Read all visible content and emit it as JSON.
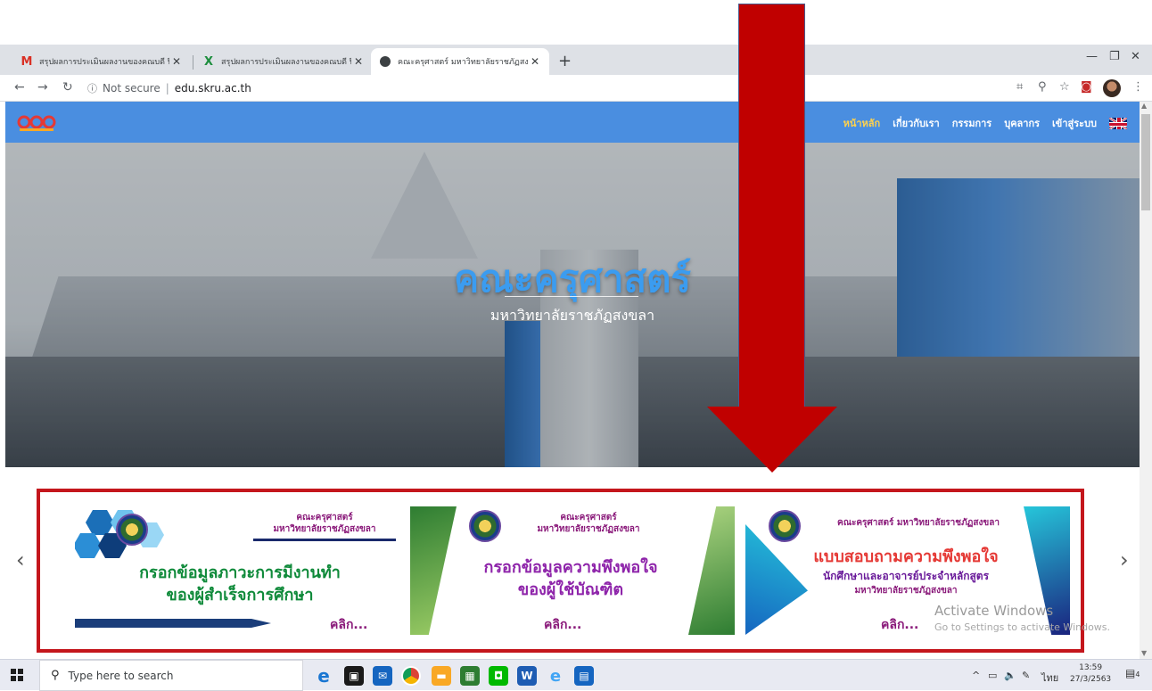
{
  "browser": {
    "tabs": [
      {
        "label": "สรุปผลการประเมินผลงานของคณบดี ปี",
        "favicon": "gmail-icon"
      },
      {
        "label": "สรุปผลการประเมินผลงานของคณบดี ปี",
        "favicon": "excel-icon"
      },
      {
        "label": "คณะครุศาสตร์ มหาวิทยาลัยราชภัฏสงข",
        "favicon": "site-icon"
      }
    ],
    "new_tab": "+",
    "address": {
      "security": "Not secure",
      "url": "edu.skru.ac.th"
    }
  },
  "site": {
    "nav": {
      "items": [
        "หน้าหลัก",
        "เกี่ยวกับเรา",
        "กรรมการ",
        "บุคลากร",
        "เข้าสู่ระบบ"
      ],
      "active_index": 0
    },
    "hero": {
      "title": "คณะครุศาสตร์",
      "subtitle": "มหาวิทยาลัยราชภัฏสงขลา"
    },
    "banners": [
      {
        "header": "คณะครุศาสตร์\nมหาวิทยาลัยราชภัฏสงขลา",
        "main": "กรอกข้อมูลภาวะการมีงานทำ\nของผู้สำเร็จการศึกษา",
        "cta": "คลิก..."
      },
      {
        "header": "คณะครุศาสตร์\nมหาวิทยาลัยราชภัฏสงขลา",
        "main": "กรอกข้อมูลความพึงพอใจ\nของผู้ใช้บัณฑิต",
        "cta": "คลิก..."
      },
      {
        "header": "คณะครุศาสตร์ มหาวิทยาลัยราชภัฏสงขลา",
        "main": "แบบสอบถามความพึงพอใจ",
        "sub": "นักศึกษาและอาจารย์ประจำหลักสูตร",
        "sub2": "มหาวิทยาลัยราชภัฏสงขลา",
        "cta": "คลิก..."
      }
    ],
    "carousel": {
      "prev": "‹",
      "next": "›"
    }
  },
  "watermark": {
    "line1": "Activate Windows",
    "line2": "Go to Settings to activate Windows."
  },
  "taskbar": {
    "search_placeholder": "Type here to search",
    "time": "13:59",
    "date": "27/3/2563",
    "lang": "ไทย",
    "notifications": "4"
  },
  "colors": {
    "nav": "#4a8ee0",
    "hero_title": "#3b9cf0",
    "highlight": "#c4161c",
    "arrow": "#c00000"
  }
}
